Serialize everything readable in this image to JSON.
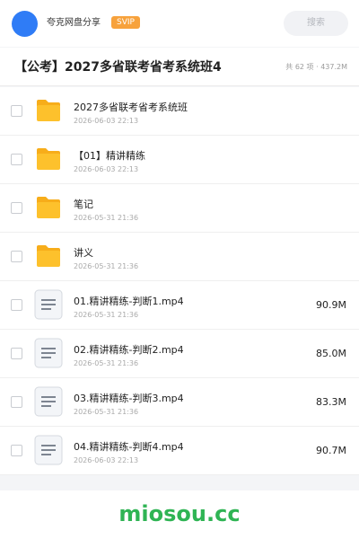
{
  "header": {
    "sharer_name": "夸克网盘分享",
    "badge": "SVIP",
    "search_placeholder": "搜索",
    "avatar_color": "#2f7cf6"
  },
  "share": {
    "title": "【公考】2027多省联考省考系统班4",
    "meta": "共 62 项 · 437.2M"
  },
  "items": [
    {
      "type": "folder",
      "icon": "folder-icon",
      "name": "2027多省联考省考系统班",
      "date": "2026-06-03 22:13",
      "size": ""
    },
    {
      "type": "folder",
      "icon": "folder-icon",
      "name": "【01】精讲精练",
      "date": "2026-06-03 22:13",
      "size": ""
    },
    {
      "type": "folder",
      "icon": "folder-icon",
      "name": "笔记",
      "date": "2026-05-31 21:36",
      "size": ""
    },
    {
      "type": "folder",
      "icon": "folder-icon",
      "name": "讲义",
      "date": "2026-05-31 21:36",
      "size": ""
    },
    {
      "type": "file",
      "icon": "document-file-icon",
      "name": "01.精讲精练-判断1.mp4",
      "date": "2026-05-31 21:36",
      "size": "90.9M"
    },
    {
      "type": "file",
      "icon": "document-file-icon",
      "name": "02.精讲精练-判断2.mp4",
      "date": "2026-05-31 21:36",
      "size": "85.0M"
    },
    {
      "type": "file",
      "icon": "document-file-icon",
      "name": "03.精讲精练-判断3.mp4",
      "date": "2026-05-31 21:36",
      "size": "83.3M"
    },
    {
      "type": "file",
      "icon": "document-file-icon",
      "name": "04.精讲精练-判断4.mp4",
      "date": "2026-06-03 22:13",
      "size": "90.7M"
    }
  ],
  "footer": {
    "watermark": "miosou.cc",
    "watermark_color": "#2fb454"
  },
  "colors": {
    "folder": "#fdc12c",
    "folder_tab": "#f7ad1a",
    "badge": "#f7a23c"
  }
}
